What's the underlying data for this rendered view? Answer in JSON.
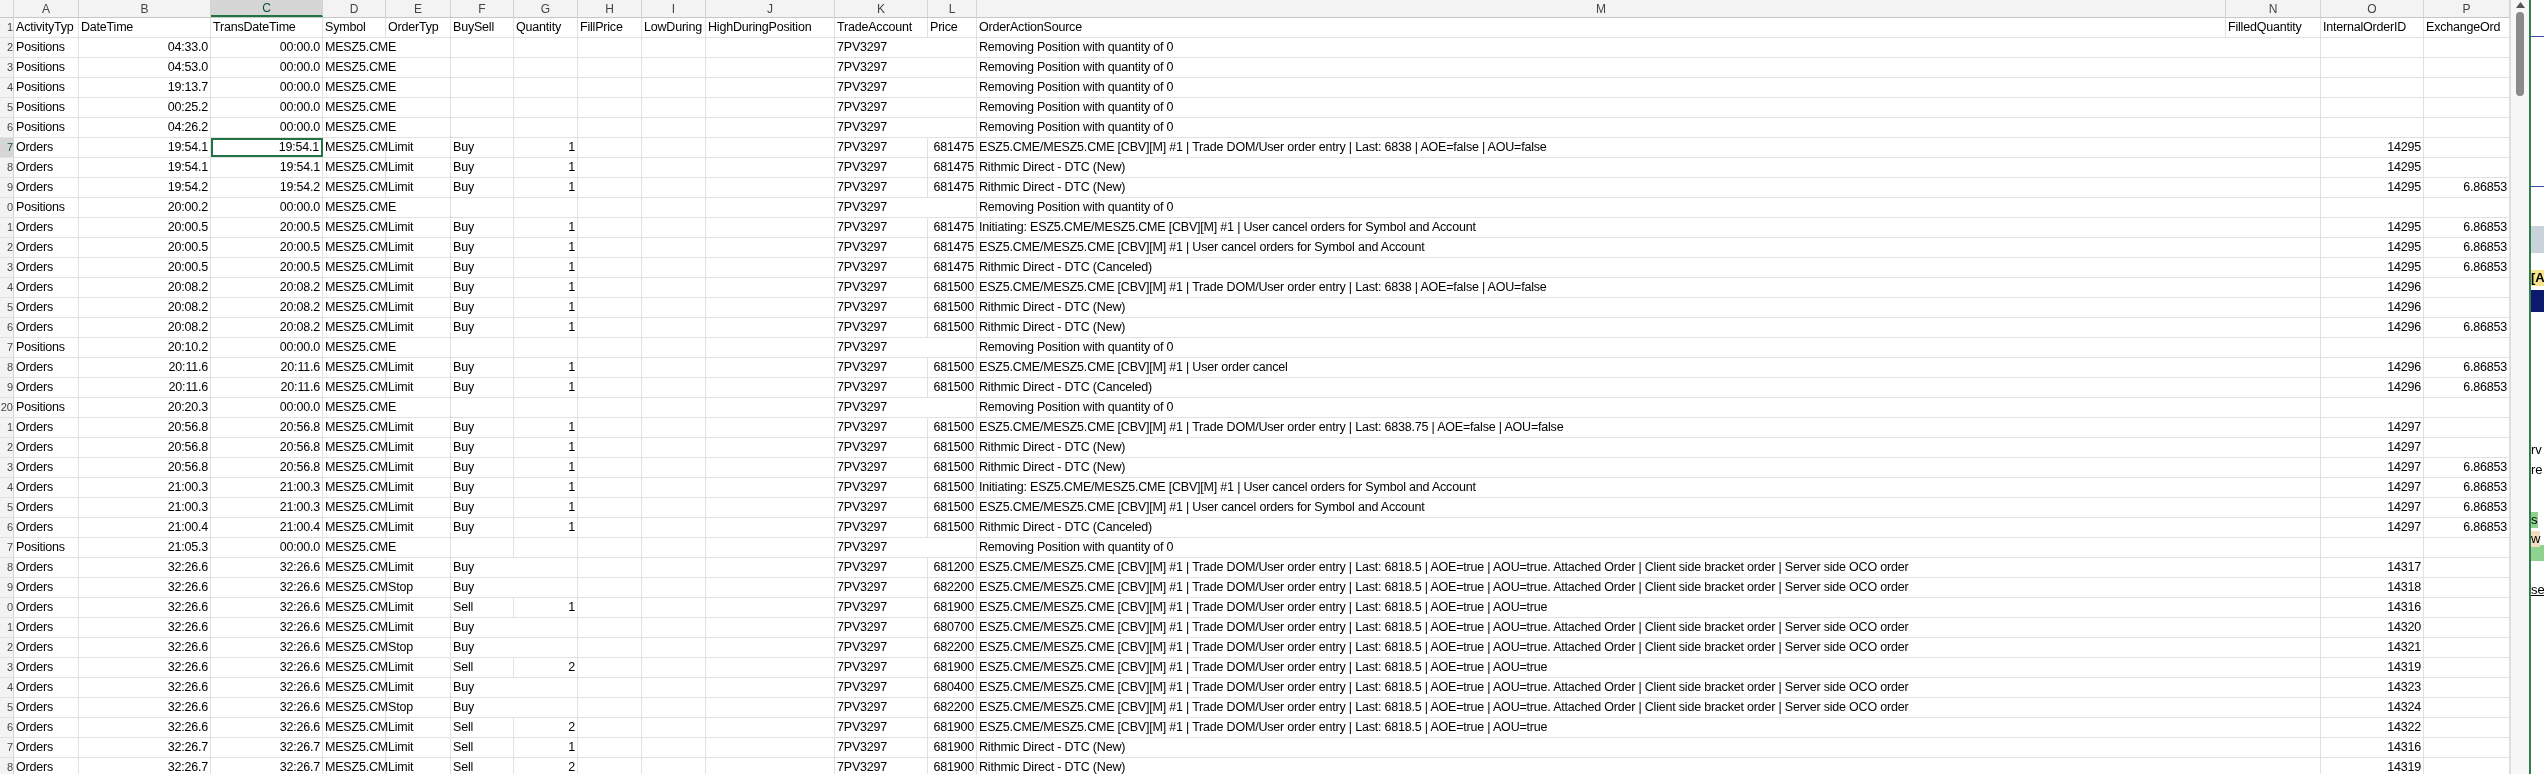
{
  "columns": [
    {
      "letter": "A",
      "kind": "text",
      "selected": false
    },
    {
      "letter": "B",
      "kind": "number",
      "selected": false
    },
    {
      "letter": "C",
      "kind": "number",
      "selected": true
    },
    {
      "letter": "D",
      "kind": "text",
      "selected": false
    },
    {
      "letter": "E",
      "kind": "text",
      "selected": false
    },
    {
      "letter": "F",
      "kind": "text",
      "selected": false
    },
    {
      "letter": "G",
      "kind": "number",
      "selected": false
    },
    {
      "letter": "H",
      "kind": "text",
      "selected": false
    },
    {
      "letter": "I",
      "kind": "text",
      "selected": false
    },
    {
      "letter": "J",
      "kind": "text",
      "selected": false
    },
    {
      "letter": "K",
      "kind": "text",
      "selected": false
    },
    {
      "letter": "L",
      "kind": "number",
      "selected": false
    },
    {
      "letter": "M",
      "kind": "text",
      "selected": false
    },
    {
      "letter": "N",
      "kind": "number",
      "selected": false
    },
    {
      "letter": "O",
      "kind": "number",
      "selected": false
    },
    {
      "letter": "P",
      "kind": "number",
      "selected": false
    }
  ],
  "rows": [
    {
      "number": "1",
      "selected": false,
      "cells": [
        "ActivityTyp",
        "DateTime",
        "TransDateTime",
        "Symbol",
        "OrderTyp",
        "BuySell",
        "Quantity",
        "FillPrice",
        "LowDuring",
        "HighDuringPosition",
        "TradeAccount",
        "Price",
        "OrderActionSource",
        "FilledQuantity",
        "InternalOrderID",
        "ExchangeOrd"
      ]
    },
    {
      "number": "2",
      "selected": false,
      "cells": [
        "Positions",
        "04:33.0",
        "00:00.0",
        "MESZ5.CME",
        null,
        null,
        null,
        null,
        null,
        null,
        "7PV3297",
        null,
        "Removing Position with quantity of 0",
        null,
        null,
        null
      ]
    },
    {
      "number": "3",
      "selected": false,
      "cells": [
        "Positions",
        "04:53.0",
        "00:00.0",
        "MESZ5.CME",
        null,
        null,
        null,
        null,
        null,
        null,
        "7PV3297",
        null,
        "Removing Position with quantity of 0",
        null,
        null,
        null
      ]
    },
    {
      "number": "4",
      "selected": false,
      "cells": [
        "Positions",
        "19:13.7",
        "00:00.0",
        "MESZ5.CME",
        null,
        null,
        null,
        null,
        null,
        null,
        "7PV3297",
        null,
        "Removing Position with quantity of 0",
        null,
        null,
        null
      ]
    },
    {
      "number": "5",
      "selected": false,
      "cells": [
        "Positions",
        "00:25.2",
        "00:00.0",
        "MESZ5.CME",
        null,
        null,
        null,
        null,
        null,
        null,
        "7PV3297",
        null,
        "Removing Position with quantity of 0",
        null,
        null,
        null
      ]
    },
    {
      "number": "6",
      "selected": false,
      "cells": [
        "Positions",
        "04:26.2",
        "00:00.0",
        "MESZ5.CME",
        null,
        null,
        null,
        null,
        null,
        null,
        "7PV3297",
        null,
        "Removing Position with quantity of 0",
        null,
        null,
        null
      ]
    },
    {
      "number": "7",
      "selected": true,
      "cells": [
        "Orders",
        "19:54.1",
        "19:54.1",
        "MESZ5.CM",
        "Limit",
        "Buy",
        "1",
        null,
        null,
        null,
        "7PV3297",
        "681475",
        "ESZ5.CME/MESZ5.CME [CBV][M] #1 | Trade DOM/User order entry | Last: 6838 | AOE=false | AOU=false",
        null,
        "14295",
        null
      ]
    },
    {
      "number": "8",
      "selected": false,
      "cells": [
        "Orders",
        "19:54.1",
        "19:54.1",
        "MESZ5.CM",
        "Limit",
        "Buy",
        "1",
        null,
        null,
        null,
        "7PV3297",
        "681475",
        "Rithmic Direct - DTC (New)",
        null,
        "14295",
        null
      ]
    },
    {
      "number": "9",
      "selected": false,
      "cells": [
        "Orders",
        "19:54.2",
        "19:54.2",
        "MESZ5.CM",
        "Limit",
        "Buy",
        "1",
        null,
        null,
        null,
        "7PV3297",
        "681475",
        "Rithmic Direct - DTC (New)",
        null,
        "14295",
        "6.86853"
      ]
    },
    {
      "number": "0",
      "selected": false,
      "cells": [
        "Positions",
        "20:00.2",
        "00:00.0",
        "MESZ5.CME",
        null,
        null,
        null,
        null,
        null,
        null,
        "7PV3297",
        null,
        "Removing Position with quantity of 0",
        null,
        null,
        null
      ]
    },
    {
      "number": "1",
      "selected": false,
      "cells": [
        "Orders",
        "20:00.5",
        "20:00.5",
        "MESZ5.CM",
        "Limit",
        "Buy",
        "1",
        null,
        null,
        null,
        "7PV3297",
        "681475",
        "Initiating: ESZ5.CME/MESZ5.CME [CBV][M] #1 | User cancel orders for Symbol and Account",
        null,
        "14295",
        "6.86853"
      ]
    },
    {
      "number": "2",
      "selected": false,
      "cells": [
        "Orders",
        "20:00.5",
        "20:00.5",
        "MESZ5.CM",
        "Limit",
        "Buy",
        "1",
        null,
        null,
        null,
        "7PV3297",
        "681475",
        "ESZ5.CME/MESZ5.CME [CBV][M] #1 | User cancel orders for Symbol and Account",
        null,
        "14295",
        "6.86853"
      ]
    },
    {
      "number": "3",
      "selected": false,
      "cells": [
        "Orders",
        "20:00.5",
        "20:00.5",
        "MESZ5.CM",
        "Limit",
        "Buy",
        "1",
        null,
        null,
        null,
        "7PV3297",
        "681475",
        "Rithmic Direct - DTC (Canceled)",
        null,
        "14295",
        "6.86853"
      ]
    },
    {
      "number": "4",
      "selected": false,
      "cells": [
        "Orders",
        "20:08.2",
        "20:08.2",
        "MESZ5.CM",
        "Limit",
        "Buy",
        "1",
        null,
        null,
        null,
        "7PV3297",
        "681500",
        "ESZ5.CME/MESZ5.CME [CBV][M] #1 | Trade DOM/User order entry | Last: 6838 | AOE=false | AOU=false",
        null,
        "14296",
        null
      ]
    },
    {
      "number": "5",
      "selected": false,
      "cells": [
        "Orders",
        "20:08.2",
        "20:08.2",
        "MESZ5.CM",
        "Limit",
        "Buy",
        "1",
        null,
        null,
        null,
        "7PV3297",
        "681500",
        "Rithmic Direct - DTC (New)",
        null,
        "14296",
        null
      ]
    },
    {
      "number": "6",
      "selected": false,
      "cells": [
        "Orders",
        "20:08.2",
        "20:08.2",
        "MESZ5.CM",
        "Limit",
        "Buy",
        "1",
        null,
        null,
        null,
        "7PV3297",
        "681500",
        "Rithmic Direct - DTC (New)",
        null,
        "14296",
        "6.86853"
      ]
    },
    {
      "number": "7",
      "selected": false,
      "cells": [
        "Positions",
        "20:10.2",
        "00:00.0",
        "MESZ5.CME",
        null,
        null,
        null,
        null,
        null,
        null,
        "7PV3297",
        null,
        "Removing Position with quantity of 0",
        null,
        null,
        null
      ]
    },
    {
      "number": "8",
      "selected": false,
      "cells": [
        "Orders",
        "20:11.6",
        "20:11.6",
        "MESZ5.CM",
        "Limit",
        "Buy",
        "1",
        null,
        null,
        null,
        "7PV3297",
        "681500",
        "ESZ5.CME/MESZ5.CME [CBV][M] #1 | User order cancel",
        null,
        "14296",
        "6.86853"
      ]
    },
    {
      "number": "9",
      "selected": false,
      "cells": [
        "Orders",
        "20:11.6",
        "20:11.6",
        "MESZ5.CM",
        "Limit",
        "Buy",
        "1",
        null,
        null,
        null,
        "7PV3297",
        "681500",
        "Rithmic Direct - DTC (Canceled)",
        null,
        "14296",
        "6.86853"
      ]
    },
    {
      "number": "20",
      "selected": false,
      "cells": [
        "Positions",
        "20:20.3",
        "00:00.0",
        "MESZ5.CME",
        null,
        null,
        null,
        null,
        null,
        null,
        "7PV3297",
        null,
        "Removing Position with quantity of 0",
        null,
        null,
        null
      ]
    },
    {
      "number": "1",
      "selected": false,
      "cells": [
        "Orders",
        "20:56.8",
        "20:56.8",
        "MESZ5.CM",
        "Limit",
        "Buy",
        "1",
        null,
        null,
        null,
        "7PV3297",
        "681500",
        "ESZ5.CME/MESZ5.CME [CBV][M] #1 | Trade DOM/User order entry | Last: 6838.75 | AOE=false | AOU=false",
        null,
        "14297",
        null
      ]
    },
    {
      "number": "2",
      "selected": false,
      "cells": [
        "Orders",
        "20:56.8",
        "20:56.8",
        "MESZ5.CM",
        "Limit",
        "Buy",
        "1",
        null,
        null,
        null,
        "7PV3297",
        "681500",
        "Rithmic Direct - DTC (New)",
        null,
        "14297",
        null
      ]
    },
    {
      "number": "3",
      "selected": false,
      "cells": [
        "Orders",
        "20:56.8",
        "20:56.8",
        "MESZ5.CM",
        "Limit",
        "Buy",
        "1",
        null,
        null,
        null,
        "7PV3297",
        "681500",
        "Rithmic Direct - DTC (New)",
        null,
        "14297",
        "6.86853"
      ]
    },
    {
      "number": "4",
      "selected": false,
      "cells": [
        "Orders",
        "21:00.3",
        "21:00.3",
        "MESZ5.CM",
        "Limit",
        "Buy",
        "1",
        null,
        null,
        null,
        "7PV3297",
        "681500",
        "Initiating: ESZ5.CME/MESZ5.CME [CBV][M] #1 | User cancel orders for Symbol and Account",
        null,
        "14297",
        "6.86853"
      ]
    },
    {
      "number": "5",
      "selected": false,
      "cells": [
        "Orders",
        "21:00.3",
        "21:00.3",
        "MESZ5.CM",
        "Limit",
        "Buy",
        "1",
        null,
        null,
        null,
        "7PV3297",
        "681500",
        "ESZ5.CME/MESZ5.CME [CBV][M] #1 | User cancel orders for Symbol and Account",
        null,
        "14297",
        "6.86853"
      ]
    },
    {
      "number": "6",
      "selected": false,
      "cells": [
        "Orders",
        "21:00.4",
        "21:00.4",
        "MESZ5.CM",
        "Limit",
        "Buy",
        "1",
        null,
        null,
        null,
        "7PV3297",
        "681500",
        "Rithmic Direct - DTC (Canceled)",
        null,
        "14297",
        "6.86853"
      ]
    },
    {
      "number": "7",
      "selected": false,
      "cells": [
        "Positions",
        "21:05.3",
        "00:00.0",
        "MESZ5.CME",
        null,
        null,
        null,
        null,
        null,
        null,
        "7PV3297",
        null,
        "Removing Position with quantity of 0",
        null,
        null,
        null
      ]
    },
    {
      "number": "8",
      "selected": false,
      "cells": [
        "Orders",
        "32:26.6",
        "32:26.6",
        "MESZ5.CM",
        "Limit",
        "Buy",
        null,
        null,
        null,
        null,
        "7PV3297",
        "681200",
        "ESZ5.CME/MESZ5.CME [CBV][M] #1 | Trade DOM/User order entry | Last: 6818.5 | AOE=true | AOU=true. Attached Order | Client side bracket order | Server side OCO order",
        null,
        "14317",
        null
      ]
    },
    {
      "number": "9",
      "selected": false,
      "cells": [
        "Orders",
        "32:26.6",
        "32:26.6",
        "MESZ5.CM",
        "Stop",
        "Buy",
        null,
        null,
        null,
        null,
        "7PV3297",
        "682200",
        "ESZ5.CME/MESZ5.CME [CBV][M] #1 | Trade DOM/User order entry | Last: 6818.5 | AOE=true | AOU=true. Attached Order | Client side bracket order | Server side OCO order",
        null,
        "14318",
        null
      ]
    },
    {
      "number": "0",
      "selected": false,
      "cells": [
        "Orders",
        "32:26.6",
        "32:26.6",
        "MESZ5.CM",
        "Limit",
        "Sell",
        "1",
        null,
        null,
        null,
        "7PV3297",
        "681900",
        "ESZ5.CME/MESZ5.CME [CBV][M] #1 | Trade DOM/User order entry | Last: 6818.5 | AOE=true | AOU=true",
        null,
        "14316",
        null
      ]
    },
    {
      "number": "1",
      "selected": false,
      "cells": [
        "Orders",
        "32:26.6",
        "32:26.6",
        "MESZ5.CM",
        "Limit",
        "Buy",
        null,
        null,
        null,
        null,
        "7PV3297",
        "680700",
        "ESZ5.CME/MESZ5.CME [CBV][M] #1 | Trade DOM/User order entry | Last: 6818.5 | AOE=true | AOU=true. Attached Order | Client side bracket order | Server side OCO order",
        null,
        "14320",
        null
      ]
    },
    {
      "number": "2",
      "selected": false,
      "cells": [
        "Orders",
        "32:26.6",
        "32:26.6",
        "MESZ5.CM",
        "Stop",
        "Buy",
        null,
        null,
        null,
        null,
        "7PV3297",
        "682200",
        "ESZ5.CME/MESZ5.CME [CBV][M] #1 | Trade DOM/User order entry | Last: 6818.5 | AOE=true | AOU=true. Attached Order | Client side bracket order | Server side OCO order",
        null,
        "14321",
        null
      ]
    },
    {
      "number": "3",
      "selected": false,
      "cells": [
        "Orders",
        "32:26.6",
        "32:26.6",
        "MESZ5.CM",
        "Limit",
        "Sell",
        "2",
        null,
        null,
        null,
        "7PV3297",
        "681900",
        "ESZ5.CME/MESZ5.CME [CBV][M] #1 | Trade DOM/User order entry | Last: 6818.5 | AOE=true | AOU=true",
        null,
        "14319",
        null
      ]
    },
    {
      "number": "4",
      "selected": false,
      "cells": [
        "Orders",
        "32:26.6",
        "32:26.6",
        "MESZ5.CM",
        "Limit",
        "Buy",
        null,
        null,
        null,
        null,
        "7PV3297",
        "680400",
        "ESZ5.CME/MESZ5.CME [CBV][M] #1 | Trade DOM/User order entry | Last: 6818.5 | AOE=true | AOU=true. Attached Order | Client side bracket order | Server side OCO order",
        null,
        "14323",
        null
      ]
    },
    {
      "number": "5",
      "selected": false,
      "cells": [
        "Orders",
        "32:26.6",
        "32:26.6",
        "MESZ5.CM",
        "Stop",
        "Buy",
        null,
        null,
        null,
        null,
        "7PV3297",
        "682200",
        "ESZ5.CME/MESZ5.CME [CBV][M] #1 | Trade DOM/User order entry | Last: 6818.5 | AOE=true | AOU=true. Attached Order | Client side bracket order | Server side OCO order",
        null,
        "14324",
        null
      ]
    },
    {
      "number": "6",
      "selected": false,
      "cells": [
        "Orders",
        "32:26.6",
        "32:26.6",
        "MESZ5.CM",
        "Limit",
        "Sell",
        "2",
        null,
        null,
        null,
        "7PV3297",
        "681900",
        "ESZ5.CME/MESZ5.CME [CBV][M] #1 | Trade DOM/User order entry | Last: 6818.5 | AOE=true | AOU=true",
        null,
        "14322",
        null
      ]
    },
    {
      "number": "7",
      "selected": false,
      "cells": [
        "Orders",
        "32:26.7",
        "32:26.7",
        "MESZ5.CM",
        "Limit",
        "Sell",
        "1",
        null,
        null,
        null,
        "7PV3297",
        "681900",
        "Rithmic Direct - DTC (New)",
        null,
        "14316",
        null
      ]
    },
    {
      "number": "8",
      "selected": false,
      "cells": [
        "Orders",
        "32:26.7",
        "32:26.7",
        "MESZ5.CM",
        "Limit",
        "Sell",
        "2",
        null,
        null,
        null,
        "7PV3297",
        "681900",
        "Rithmic Direct - DTC (New)",
        null,
        "14319",
        null
      ]
    }
  ],
  "background_window": {
    "fragments": [
      {
        "kind": "yellow",
        "text": "[A"
      },
      {
        "kind": "plain",
        "text": "rv"
      },
      {
        "kind": "plain",
        "text": "re"
      },
      {
        "kind": "green",
        "text": "s"
      },
      {
        "kind": "tan",
        "text": "w"
      },
      {
        "kind": "link",
        "text": "se"
      }
    ]
  }
}
